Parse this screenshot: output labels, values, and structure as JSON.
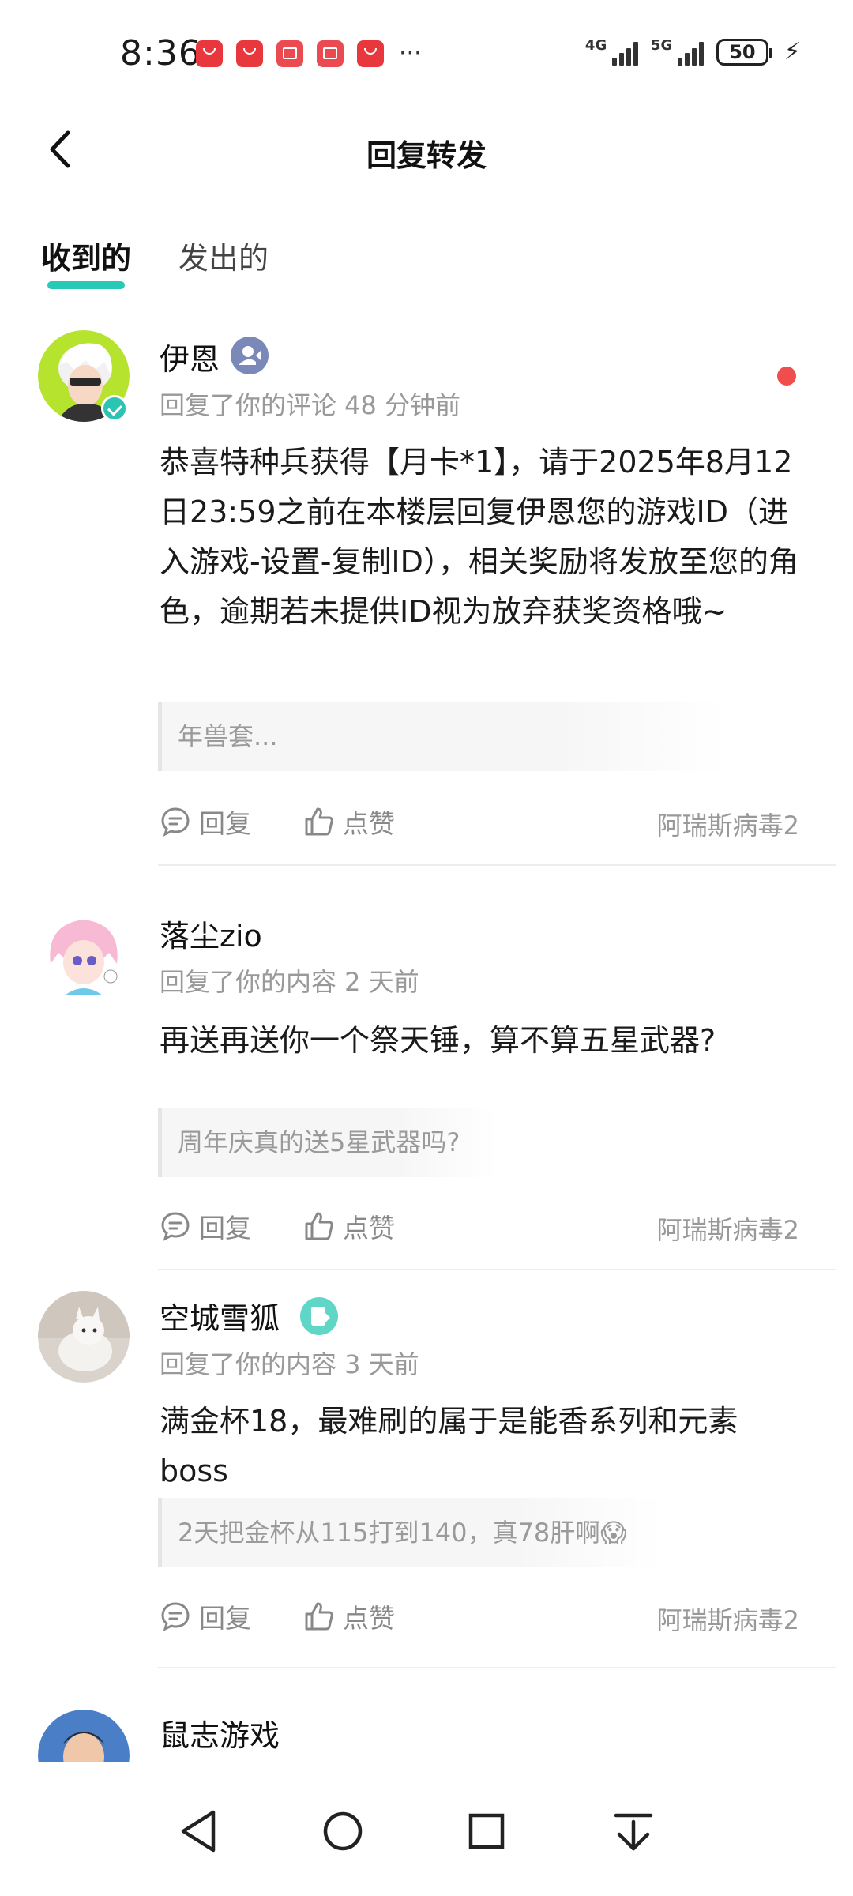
{
  "status_bar": {
    "time": "8:36",
    "net1": "4G",
    "net2": "5G",
    "battery": "50",
    "apps": [
      "huawei-store",
      "huawei-store",
      "reader",
      "reader",
      "huawei-store"
    ],
    "more": "···"
  },
  "header": {
    "title": "回复转发"
  },
  "tabs": [
    {
      "label": "收到的",
      "active": true
    },
    {
      "label": "发出的",
      "active": false
    }
  ],
  "cards": [
    {
      "username": "伊恩",
      "meta": "回复了你的评论 48 分钟前",
      "content": "恭喜特种兵获得【月卡*1】，请于2025年8月12日23:59之前在本楼层回复伊恩您的游戏ID（进入游戏-设置-复制ID），相关奖励将发放至您的角色，逾期若未提供ID视为放弃获奖资格哦~",
      "quote": "年兽套...",
      "reply_label": "回复",
      "like_label": "点赞",
      "source": "阿瑞斯病毒2",
      "unread": true
    },
    {
      "username": "落尘zio",
      "meta": "回复了你的内容 2 天前",
      "content": "再送再送你一个祭天锤，算不算五星武器?",
      "quote": "周年庆真的送5星武器吗?",
      "reply_label": "回复",
      "like_label": "点赞",
      "source": "阿瑞斯病毒2",
      "unread": false
    },
    {
      "username": "空城雪狐",
      "meta": "回复了你的内容 3 天前",
      "content": "满金杯18，最难刷的属于是能香系列和元素boss",
      "quote": "2天把金杯从115打到140，真78肝啊😱",
      "reply_label": "回复",
      "like_label": "点赞",
      "source": "阿瑞斯病毒2",
      "unread": false
    },
    {
      "username": "鼠志游戏",
      "unread": false
    }
  ],
  "colors": {
    "accent": "#29c9b8",
    "unread_dot": "#f04e4e",
    "meta_text": "#999999"
  }
}
